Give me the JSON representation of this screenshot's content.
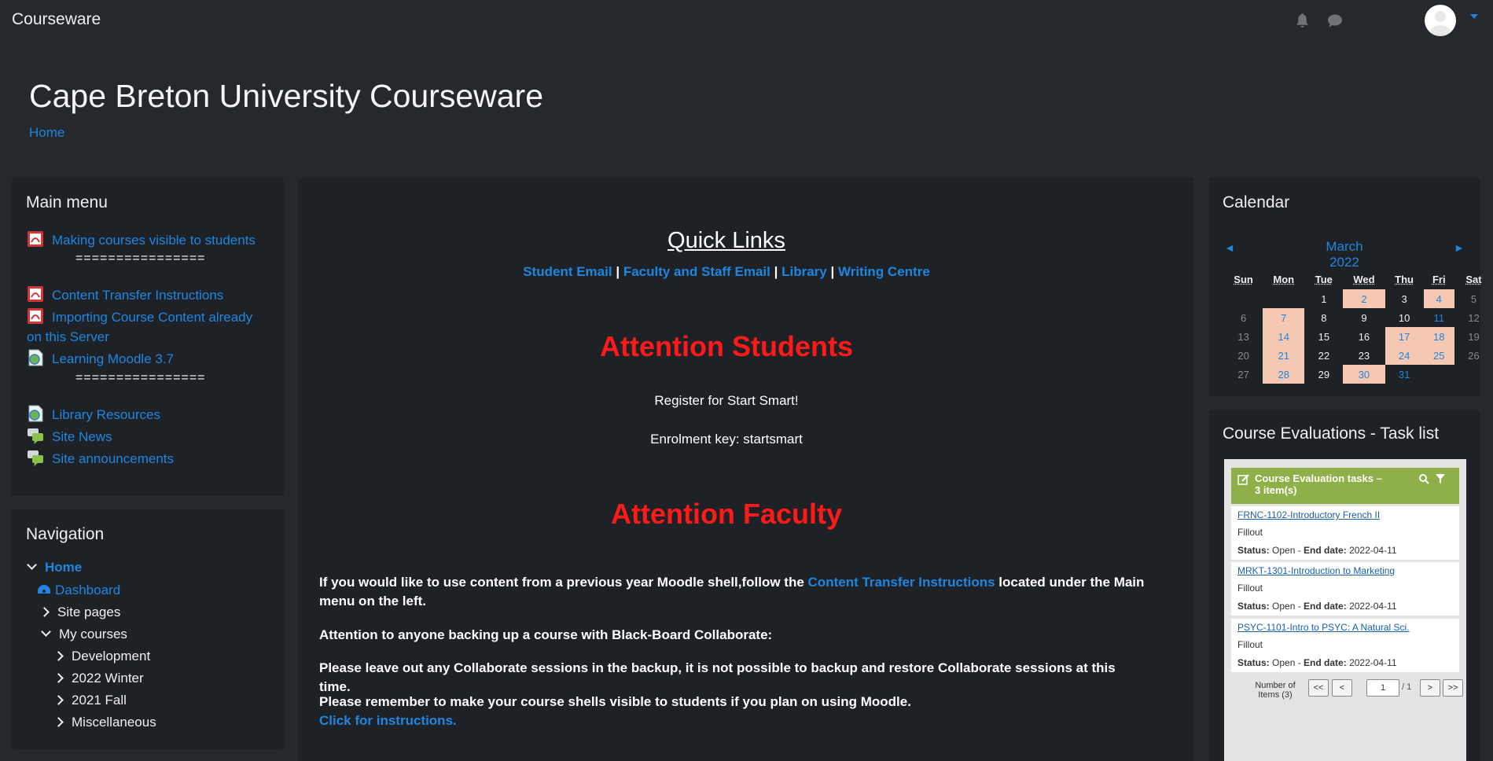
{
  "topbar": {
    "brand": "Courseware"
  },
  "header": {
    "title": "Cape Breton University Courseware",
    "breadcrumb": "Home"
  },
  "main_menu": {
    "title": "Main menu",
    "items": [
      {
        "label": "Making courses visible to students",
        "icon": "pdf-icon"
      },
      {
        "label": "Content Transfer Instructions",
        "icon": "pdf-icon"
      },
      {
        "label": "Importing Course Content already on this Server",
        "icon": "pdf-icon"
      },
      {
        "label": "Learning Moodle 3.7",
        "icon": "url-icon"
      },
      {
        "label": "Library Resources",
        "icon": "url-icon"
      },
      {
        "label": "Site News",
        "icon": "forum-icon"
      },
      {
        "label": "Site announcements",
        "icon": "forum-icon"
      }
    ],
    "separator": "================"
  },
  "navigation": {
    "title": "Navigation",
    "home": "Home",
    "dashboard": "Dashboard",
    "site_pages": "Site pages",
    "my_courses": "My courses",
    "courses": [
      "Development",
      "2022 Winter",
      "2021 Fall",
      "Miscellaneous"
    ]
  },
  "center": {
    "quick_links_title": "Quick Links",
    "quick_links": [
      "Student Email",
      "Faculty and Staff Email",
      "Library",
      "Writing Centre"
    ],
    "link_sep": "|",
    "att_students": "Attention Students",
    "register": "Register for Start Smart!",
    "enrol_key": "Enrolment key:  startsmart",
    "att_faculty": "Attention Faculty",
    "para1_a": "If you would like to use content from a previous year Moodle shell,follow the ",
    "para1_link": "Content Transfer Instructions",
    "para1_b": " located under the Main menu on the left.",
    "para2": "Attention to anyone backing up a course with Black-Board Collaborate:",
    "para3": "Please leave out any Collaborate sessions in the backup, it is not possible to backup and restore Collaborate sessions at this time.",
    "para4": "Please remember to make your course shells visible to students if you plan on using Moodle.",
    "para4_link": "Click for instructions."
  },
  "calendar": {
    "title": "Calendar",
    "month": "March 2022",
    "prev": "◄",
    "next": "►",
    "days": [
      "Sun",
      "Mon",
      "Tue",
      "Wed",
      "Thu",
      "Fri",
      "Sat"
    ],
    "weeks": [
      [
        "",
        "",
        "1",
        "2",
        "3",
        "4",
        "5"
      ],
      [
        "6",
        "7",
        "8",
        "9",
        "10",
        "11",
        "12"
      ],
      [
        "13",
        "14",
        "15",
        "16",
        "17",
        "18",
        "19"
      ],
      [
        "20",
        "21",
        "22",
        "23",
        "24",
        "25",
        "26"
      ],
      [
        "27",
        "28",
        "29",
        "30",
        "31",
        "",
        ""
      ]
    ],
    "highlighted": [
      "2",
      "4",
      "7",
      "14",
      "17",
      "18",
      "21",
      "24",
      "25",
      "28",
      "30"
    ],
    "linked": [
      "11",
      "31"
    ]
  },
  "course_eval": {
    "title": "Course Evaluations - Task list",
    "bar_label": "Course Evaluation tasks  –  3 item(s)",
    "tasks": [
      {
        "course": "FRNC-1102-Introductory French II",
        "type": "Fillout",
        "status_label": "Status:",
        "status": "Open - ",
        "end_label": "End date:",
        "end": "2022-04-11"
      },
      {
        "course": "MRKT-1301-Introduction to Marketing",
        "type": "Fillout",
        "status_label": "Status:",
        "status": "Open - ",
        "end_label": "End date:",
        "end": "2022-04-11"
      },
      {
        "course": "PSYC-1101-Intro to PSYC: A Natural Sci.",
        "type": "Fillout",
        "status_label": "Status:",
        "status": "Open - ",
        "end_label": "End date:",
        "end": "2022-04-11"
      }
    ],
    "num_items_label": "Number of Items (3)",
    "first": "<<",
    "prev": "<",
    "page": "1",
    "of": "/ 1",
    "next": ">",
    "last": ">>"
  },
  "colors": {
    "bg": "#25282d",
    "panel": "#1e2125",
    "link": "#1f86e0",
    "attention": "#ff1a1a",
    "cal_highlight": "#f5c8b4",
    "task_bar": "#8fb048"
  }
}
